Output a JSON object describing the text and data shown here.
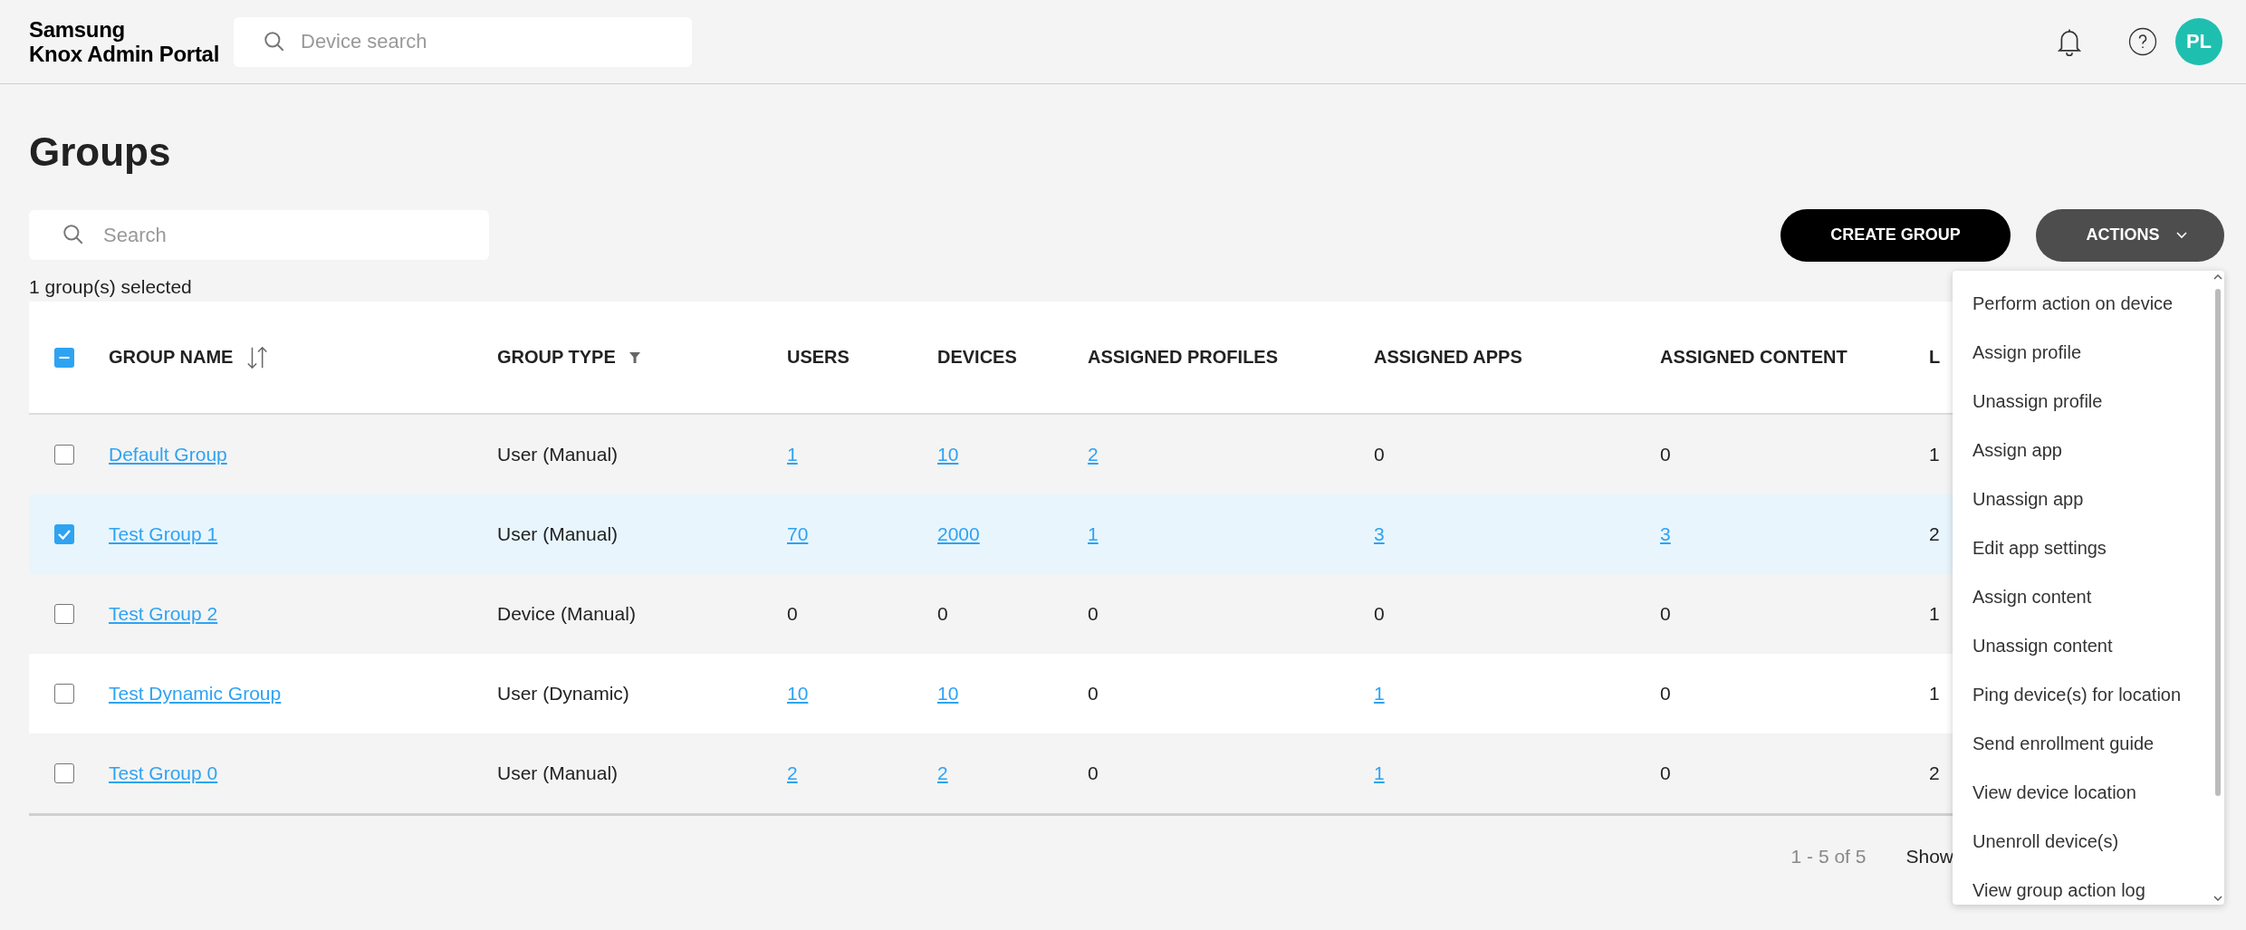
{
  "header": {
    "logo_line_1": "Samsung",
    "logo_line_2": "Knox Admin Portal",
    "device_search": {
      "placeholder": "Device search"
    },
    "avatar": "PL"
  },
  "page": {
    "title": "Groups",
    "search": {
      "placeholder": "Search"
    },
    "create_button": "CREATE GROUP",
    "actions_button": "ACTIONS",
    "selection_summary": "1 group(s) selected"
  },
  "table": {
    "select_all": {
      "partial": true
    },
    "columns": [
      {
        "label": "GROUP NAME",
        "kind": "sortable"
      },
      {
        "label": "GROUP TYPE",
        "kind": "filterable"
      },
      {
        "label": "USERS",
        "kind": "plain"
      },
      {
        "label": "DEVICES",
        "kind": "plain"
      },
      {
        "label": "ASSIGNED PROFILES",
        "kind": "plain"
      },
      {
        "label": "ASSIGNED APPS",
        "kind": "plain"
      },
      {
        "label": "ASSIGNED CONTENT",
        "kind": "plain"
      },
      {
        "label": "L",
        "kind": "plain"
      }
    ],
    "rows": [
      {
        "selected": false,
        "cells": [
          {
            "text": "Default Group",
            "link": true
          },
          {
            "text": "User (Manual)",
            "link": false
          },
          {
            "text": "1",
            "link": true
          },
          {
            "text": "10",
            "link": true
          },
          {
            "text": "2",
            "link": true
          },
          {
            "text": "0",
            "link": false
          },
          {
            "text": "0",
            "link": false
          },
          {
            "text": "1",
            "link": false
          }
        ]
      },
      {
        "selected": true,
        "cells": [
          {
            "text": "Test Group 1",
            "link": true
          },
          {
            "text": "User (Manual)",
            "link": false
          },
          {
            "text": "70",
            "link": true
          },
          {
            "text": "2000",
            "link": true
          },
          {
            "text": "1",
            "link": true
          },
          {
            "text": "3",
            "link": true
          },
          {
            "text": "3",
            "link": true
          },
          {
            "text": "2",
            "link": false
          }
        ]
      },
      {
        "selected": false,
        "cells": [
          {
            "text": "Test Group 2",
            "link": true
          },
          {
            "text": "Device (Manual)",
            "link": false
          },
          {
            "text": "0",
            "link": false
          },
          {
            "text": "0",
            "link": false
          },
          {
            "text": "0",
            "link": false
          },
          {
            "text": "0",
            "link": false
          },
          {
            "text": "0",
            "link": false
          },
          {
            "text": "1",
            "link": false
          }
        ]
      },
      {
        "selected": false,
        "cells": [
          {
            "text": "Test Dynamic Group",
            "link": true
          },
          {
            "text": "User (Dynamic)",
            "link": false
          },
          {
            "text": "10",
            "link": true
          },
          {
            "text": "10",
            "link": true
          },
          {
            "text": "0",
            "link": false
          },
          {
            "text": "1",
            "link": true
          },
          {
            "text": "0",
            "link": false
          },
          {
            "text": "1",
            "link": false
          }
        ]
      },
      {
        "selected": false,
        "cells": [
          {
            "text": "Test Group 0",
            "link": true
          },
          {
            "text": "User (Manual)",
            "link": false
          },
          {
            "text": "2",
            "link": true
          },
          {
            "text": "2",
            "link": true
          },
          {
            "text": "0",
            "link": false
          },
          {
            "text": "1",
            "link": true
          },
          {
            "text": "0",
            "link": false
          },
          {
            "text": "2",
            "link": false
          }
        ]
      }
    ]
  },
  "pagination": {
    "range": "1 - 5 of 5",
    "show_label": "Show"
  },
  "actions_menu": {
    "items": [
      "Perform action on device",
      "Assign profile",
      "Unassign profile",
      "Assign app",
      "Unassign app",
      "Edit app settings",
      "Assign content",
      "Unassign content",
      "Ping device(s) for location",
      "Send enrollment guide",
      "View device location",
      "Unenroll device(s)",
      "View group action log"
    ]
  }
}
